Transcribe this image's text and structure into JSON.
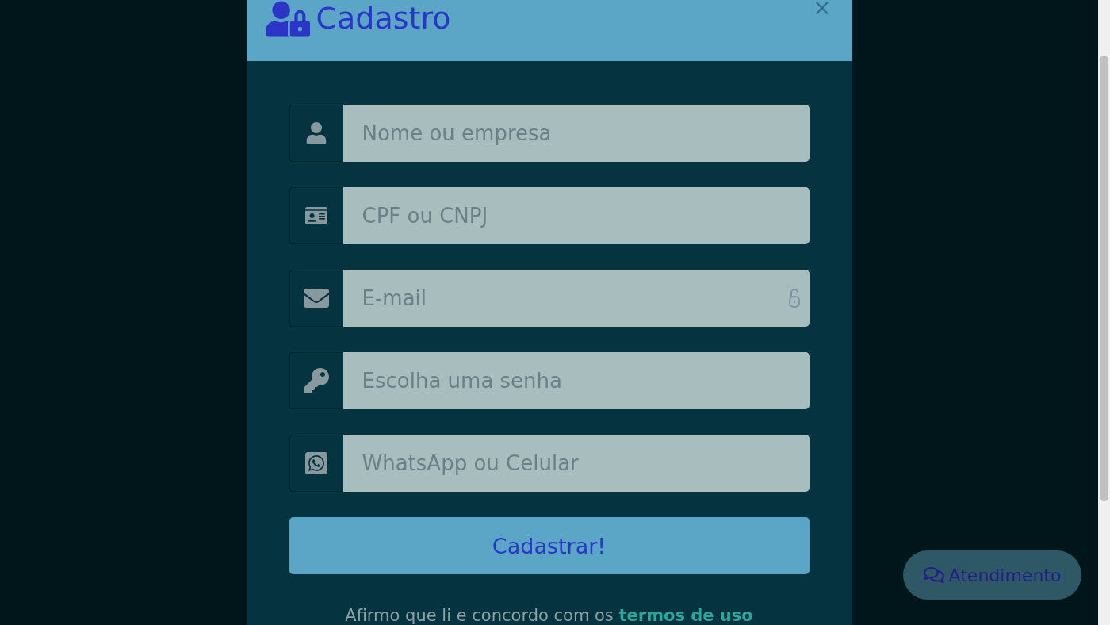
{
  "modal": {
    "title": "Cadastro",
    "close": "×"
  },
  "fields": [
    {
      "kind": "name",
      "placeholder": "Nome ou empresa"
    },
    {
      "kind": "document",
      "placeholder": "CPF ou CNPJ"
    },
    {
      "kind": "email",
      "placeholder": "E-mail"
    },
    {
      "kind": "password",
      "placeholder": "Escolha uma senha"
    },
    {
      "kind": "phone",
      "placeholder": "WhatsApp ou Celular"
    }
  ],
  "submit": "Cadastrar!",
  "terms": {
    "text": "Afirmo que li e concordo com os",
    "link": "termos de uso"
  },
  "chat_button": "Atendimento"
}
